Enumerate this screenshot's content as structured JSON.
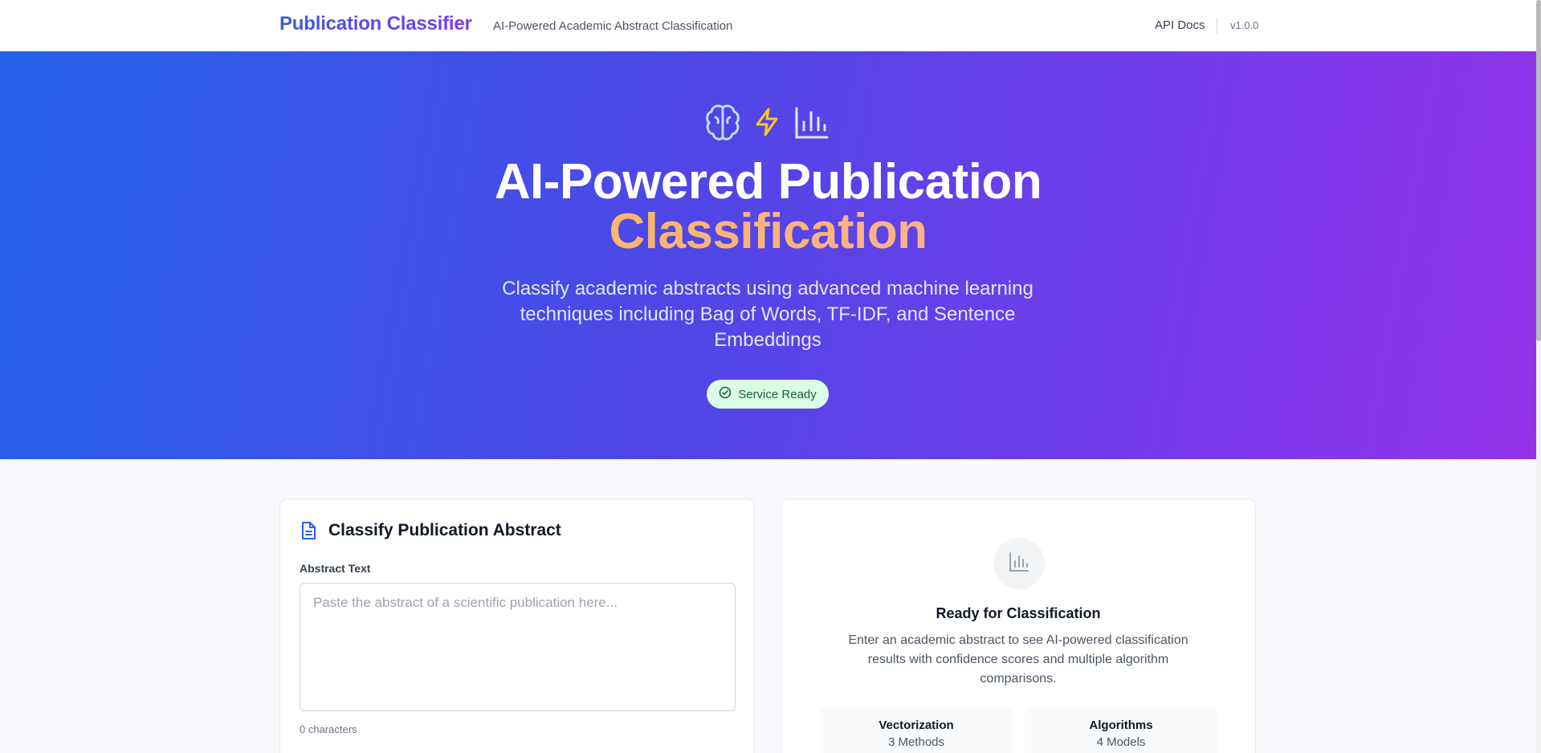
{
  "header": {
    "brand": "Publication Classifier",
    "tagline": "AI-Powered Academic Abstract Classification",
    "api_docs": "API Docs",
    "version": "v1.0.0"
  },
  "hero": {
    "icons": [
      "brain-icon",
      "lightning-icon",
      "bar-chart-icon"
    ],
    "title_line1": "AI-Powered Publication",
    "title_line2": "Classification",
    "description": "Classify academic abstracts using advanced machine learning techniques including Bag of Words, TF-IDF, and Sentence Embeddings",
    "status": "Service Ready"
  },
  "form": {
    "title": "Classify Publication Abstract",
    "field_label": "Abstract Text",
    "placeholder": "Paste the abstract of a scientific publication here...",
    "char_count": "0 characters"
  },
  "results": {
    "title": "Ready for Classification",
    "description": "Enter an academic abstract to see AI-powered classification results with confidence scores and multiple algorithm comparisons.",
    "stats": [
      {
        "label": "Vectorization",
        "value": "3 Methods"
      },
      {
        "label": "Algorithms",
        "value": "4 Models"
      }
    ]
  },
  "colors": {
    "brand_start": "#3b5bdb",
    "brand_end": "#7c3aed",
    "hero_start": "#2563eb",
    "hero_end": "#9333ea",
    "accent_yellow": "#fbbf24",
    "status_bg": "#dcfce7",
    "status_text": "#166534"
  }
}
